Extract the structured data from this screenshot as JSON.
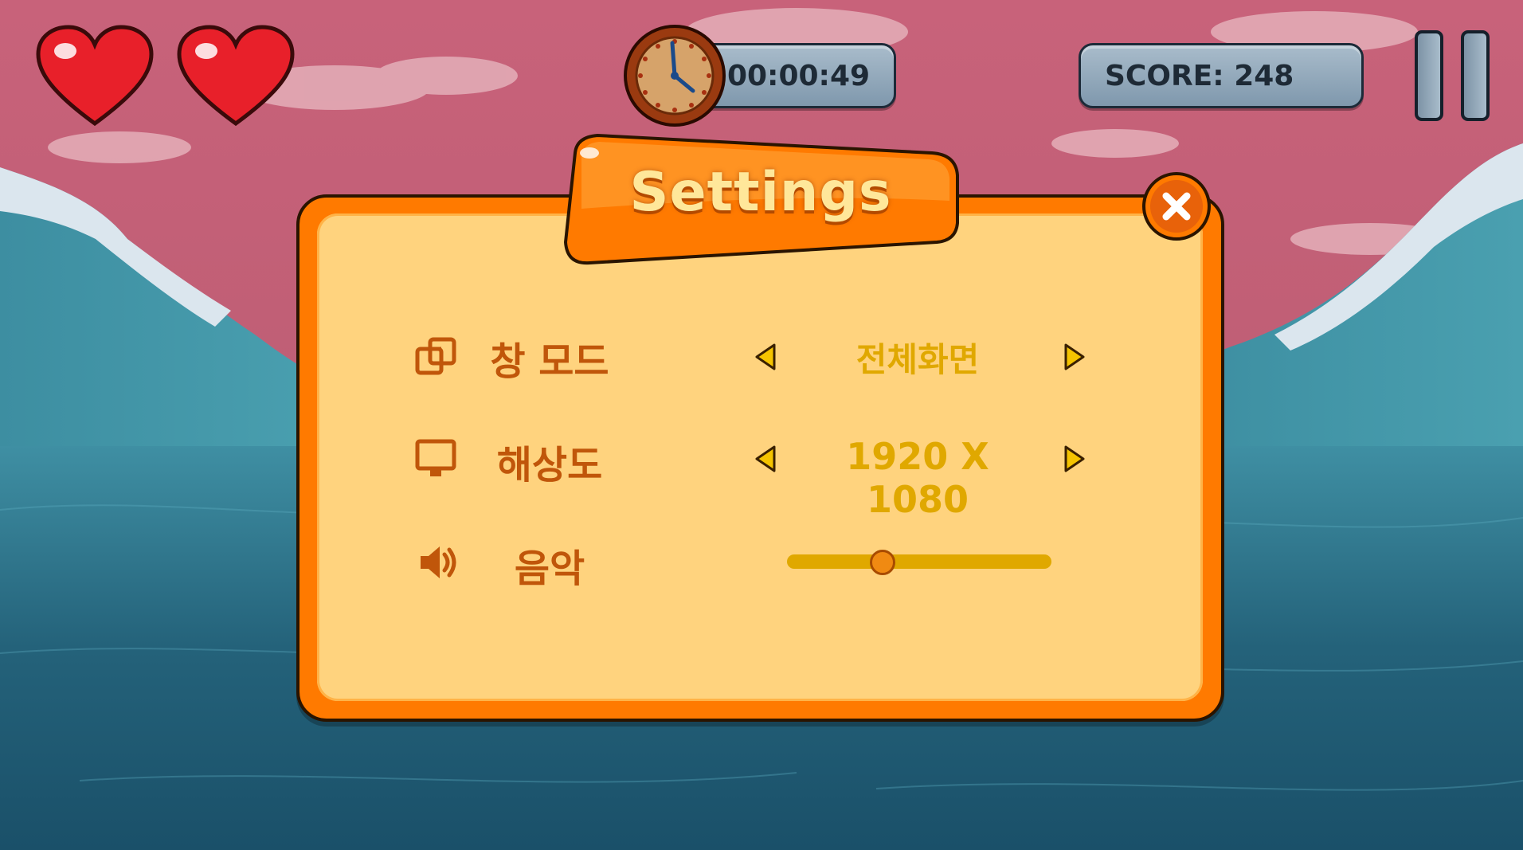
{
  "hud": {
    "lives": 2,
    "timer": "00:00:49",
    "score": "SCORE: 248"
  },
  "dialog": {
    "title": "Settings",
    "settings": [
      {
        "icon": "window-mode-icon",
        "label": "창 모드",
        "value": "전체화면"
      },
      {
        "icon": "monitor-icon",
        "label": "해상도",
        "value": "1920 X 1080"
      },
      {
        "icon": "speaker-icon",
        "label": "음악",
        "slider_level": 0.36
      }
    ]
  },
  "colors": {
    "panel_orange": "#ff7a00",
    "panel_fill": "#ffd37e",
    "label_brown": "#c0560a",
    "value_gold": "#e0a800",
    "sky_pink": "#c45f74",
    "sea_blue": "#2a6f86"
  }
}
